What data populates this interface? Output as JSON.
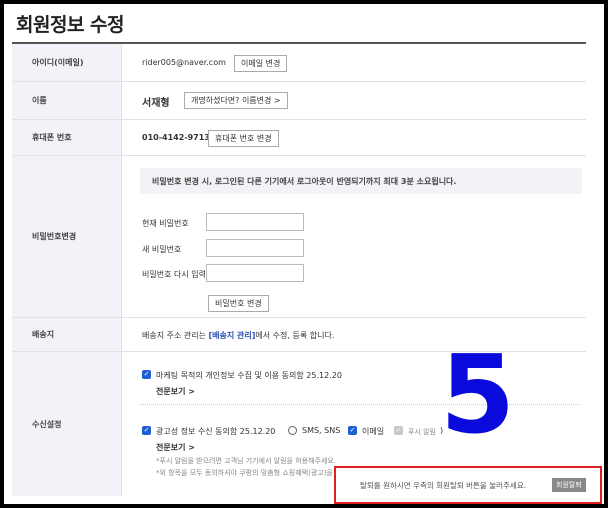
{
  "page": {
    "title": "회원정보 수정"
  },
  "account": {
    "id_label": "아이디(이메일)",
    "email": "rider005@naver.com",
    "email_change_button": "이메일 변경"
  },
  "name_row": {
    "label": "이름",
    "value": "서재형",
    "change_button": "개명하셨다면? 이름변경 >"
  },
  "phone_row": {
    "label": "휴대폰 번호",
    "value": "010-4142-9713",
    "change_button": "휴대폰 번호 변경"
  },
  "password_row": {
    "label": "비밀번호변경",
    "notice": "비밀번호 변경 시, 로그인된 다른 기기에서 로그아웃이 반영되기까지 최대 3분 소요됩니다.",
    "current_label": "현재 비밀번호",
    "new_label": "새 비밀번호",
    "confirm_label": "비밀번호 다시 입력",
    "submit_button": "비밀번호 변경"
  },
  "shipping_row": {
    "label": "배송지",
    "text_before": "배송지 주소 관리는 ",
    "link": "[배송지 관리]",
    "text_after": "에서 수정, 등록 합니다."
  },
  "receive_row": {
    "label": "수신설정",
    "marketing_consent": "마케팅 목적의 개인정보 수집 및 이용 동의함 25.12.20",
    "marketing_detail": "전문보기 >",
    "ad_consent": "광고성 정보 수신 동의함 25.12.20",
    "sms_option": "SMS, SNS",
    "email_option": "이메일",
    "push_option": "푸시 알림",
    "paren_close": ")",
    "ad_detail": "전문보기 >",
    "note1": "*푸시 알림을 받으려면 고객님 기기에서 알림을 허용해주세요.",
    "note2": "*위 항목을 모두 동의하셔야 쿠팡의 맞춤형 쇼핑혜택(광고)을 받으실 수 있습니다."
  },
  "overlay": {
    "number": "5"
  },
  "withdraw": {
    "text": "탈퇴를 원하시면 우측의 회원탈퇴 버튼을 눌러주세요.",
    "button": "회원탈퇴"
  },
  "colors": {
    "accent": "#1f5fd6",
    "highlight_border": "#e02020",
    "overlay_number": "#0a0adc"
  }
}
